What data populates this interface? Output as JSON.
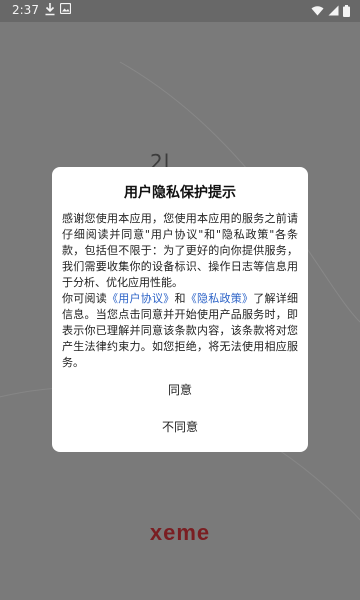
{
  "status_bar": {
    "time": "2:37",
    "download_icon": "download-icon",
    "image_icon": "image-icon",
    "wifi_icon": "wifi-icon",
    "signal_icon": "signal-icon",
    "battery_icon": "battery-icon"
  },
  "background": {
    "glyph": "2l",
    "logo_text": "xeme"
  },
  "dialog": {
    "title": "用户隐私保护提示",
    "paragraph1": "感谢您使用本应用，您使用本应用的服务之前请仔细阅读并同意\"用户协议\"和\"隐私政策\"各条款，包括但不限于：为了更好的向你提供服务，我们需要收集你的设备标识、操作日志等信息用于分析、优化应用性能。",
    "p2_prefix": "你可阅读",
    "user_agreement_link": "《用户协议》",
    "p2_and": "和",
    "privacy_policy_link": "《隐私政策》",
    "p2_suffix": "了解详细信息。当您点击同意并开始使用产品服务时，即表示你已理解并同意该条款内容，该条款将对您产生法律约束力。如您拒绝，将无法使用相应服务。",
    "agree_label": "同意",
    "disagree_label": "不同意"
  },
  "colors": {
    "overlay": "#7a7a7a",
    "link": "#2b62c7",
    "logo": "#7a1e22"
  }
}
